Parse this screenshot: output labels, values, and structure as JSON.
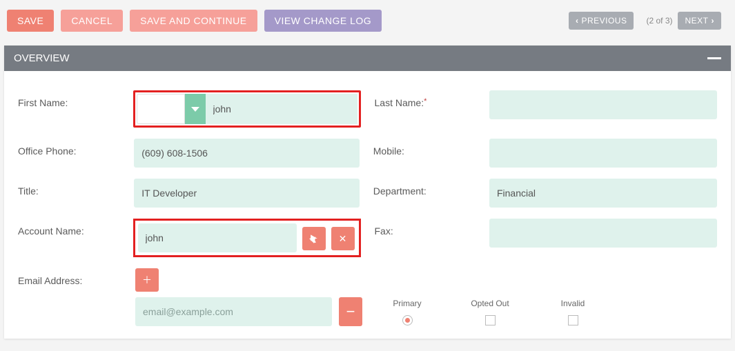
{
  "toolbar": {
    "save": "SAVE",
    "cancel": "CANCEL",
    "save_continue": "SAVE AND CONTINUE",
    "view_log": "VIEW CHANGE LOG",
    "previous": "PREVIOUS",
    "page_ind": "(2 of 3)",
    "next": "NEXT"
  },
  "panel": {
    "title": "OVERVIEW"
  },
  "labels": {
    "first_name": "First Name:",
    "last_name": "Last Name:",
    "office_phone": "Office Phone:",
    "mobile": "Mobile:",
    "title": "Title:",
    "department": "Department:",
    "account_name": "Account Name:",
    "fax": "Fax:",
    "email": "Email Address:",
    "primary": "Primary",
    "opted_out": "Opted Out",
    "invalid": "Invalid",
    "required": "*"
  },
  "values": {
    "first_name": "john",
    "last_name": "",
    "office_phone": "(609) 608-1506",
    "mobile": "",
    "title": "IT Developer",
    "department": "Financial",
    "account_name": "john",
    "fax": "",
    "email_placeholder": "email@example.com"
  }
}
